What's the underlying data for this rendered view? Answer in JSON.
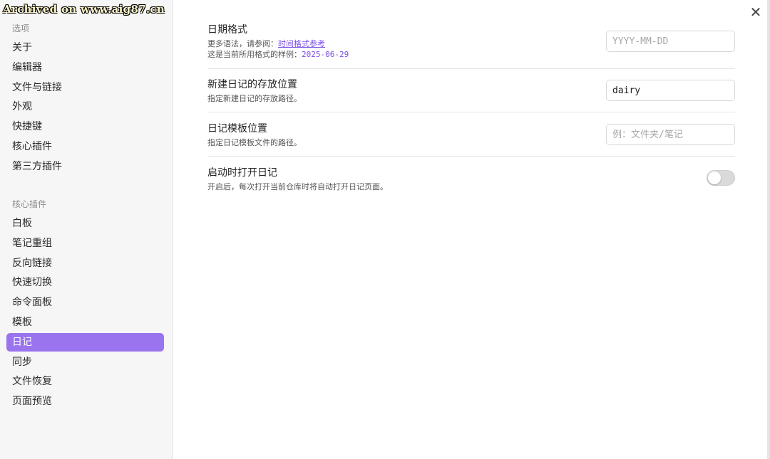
{
  "watermark": "Archived on www.aig87.cn",
  "sidebar": {
    "options_title": "选项",
    "options": [
      {
        "label": "关于"
      },
      {
        "label": "编辑器"
      },
      {
        "label": "文件与链接"
      },
      {
        "label": "外观"
      },
      {
        "label": "快捷键"
      },
      {
        "label": "核心插件"
      },
      {
        "label": "第三方插件"
      }
    ],
    "plugins_title": "核心插件",
    "plugins": [
      {
        "label": "白板"
      },
      {
        "label": "笔记重组"
      },
      {
        "label": "反向链接"
      },
      {
        "label": "快速切换"
      },
      {
        "label": "命令面板"
      },
      {
        "label": "模板"
      },
      {
        "label": "日记",
        "active": true
      },
      {
        "label": "同步"
      },
      {
        "label": "文件恢复"
      },
      {
        "label": "页面预览"
      }
    ]
  },
  "close_icon": "close-icon",
  "colors": {
    "accent": "#9a74ef",
    "link": "#7b4fe8"
  },
  "settings": {
    "date_format": {
      "title": "日期格式",
      "desc_prefix": "更多语法，请参阅：",
      "link": "时间格式参考",
      "sample_prefix": "这是当前所用格式的样例：",
      "sample_value": "2025-06-29",
      "placeholder": "YYYY-MM-DD",
      "value": ""
    },
    "new_location": {
      "title": "新建日记的存放位置",
      "desc": "指定新建日记的存放路径。",
      "placeholder": "",
      "value": "dairy"
    },
    "template_location": {
      "title": "日记模板位置",
      "desc": "指定日记模板文件的路径。",
      "placeholder": "例：文件夹/笔记",
      "value": ""
    },
    "open_on_startup": {
      "title": "启动时打开日记",
      "desc": "开启后，每次打开当前仓库时将自动打开日记页面。",
      "enabled": false
    }
  }
}
